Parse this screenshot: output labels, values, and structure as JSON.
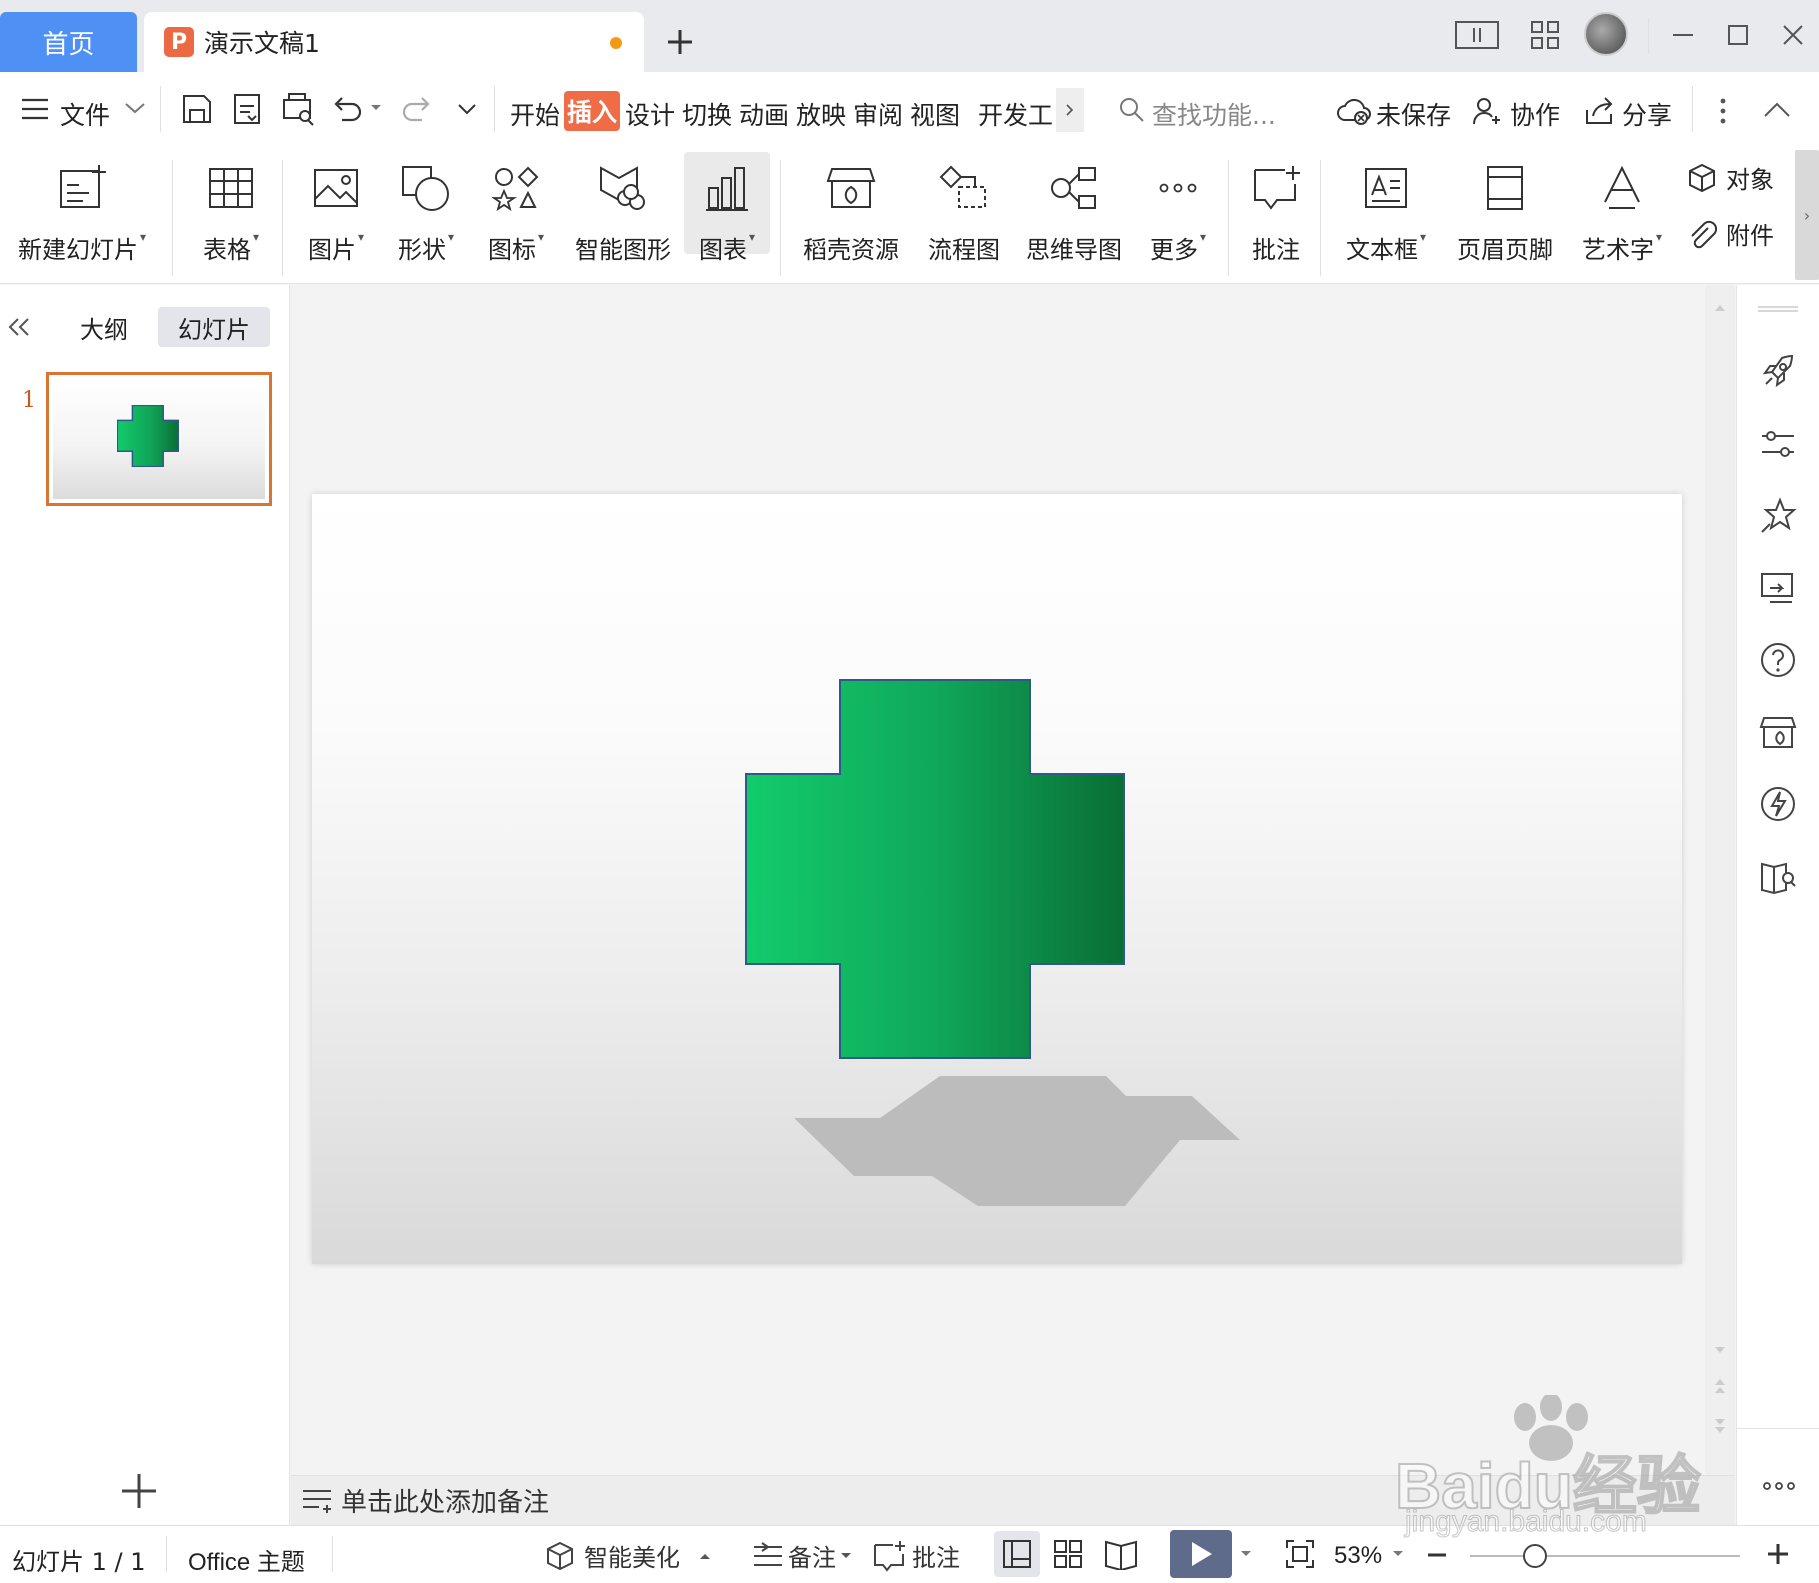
{
  "titlebar": {
    "home_tab": "首页",
    "doc_tab": "演示文稿1",
    "doc_icon_letter": "P"
  },
  "menu": {
    "file": "文件",
    "tabs": [
      "开始",
      "插入",
      "设计",
      "切换",
      "动画",
      "放映",
      "审阅",
      "视图",
      "开发工"
    ],
    "active_tab": "插入",
    "search_placeholder": "查找功能...",
    "unsaved": "未保存",
    "collab": "协作",
    "share": "分享"
  },
  "ribbon": {
    "new_slide": "新建幻灯片",
    "table": "表格",
    "picture": "图片",
    "shape": "形状",
    "icon": "图标",
    "smart_art": "智能图形",
    "chart": "图表",
    "docer": "稻壳资源",
    "flowchart": "流程图",
    "mindmap": "思维导图",
    "more": "更多",
    "comment": "批注",
    "textbox": "文本框",
    "header_footer": "页眉页脚",
    "wordart": "艺术字",
    "object": "对象",
    "attachment": "附件"
  },
  "leftpanel": {
    "tab_outline": "大纲",
    "tab_slides": "幻灯片",
    "slide_number": "1"
  },
  "notes": {
    "placeholder": "单击此处添加备注"
  },
  "status": {
    "slide_info": "幻灯片 1 / 1",
    "theme": "Office 主题",
    "beautify": "智能美化",
    "notes": "备注",
    "comment": "批注",
    "zoom": "53%"
  },
  "colors": {
    "accent": "#ef6c46",
    "home_tab": "#4e90f4",
    "cross_light": "#12cb6b",
    "cross_dark": "#0a6e35"
  },
  "watermark": {
    "brand": "Baidu经验",
    "url": "jingyan.baidu.com"
  }
}
